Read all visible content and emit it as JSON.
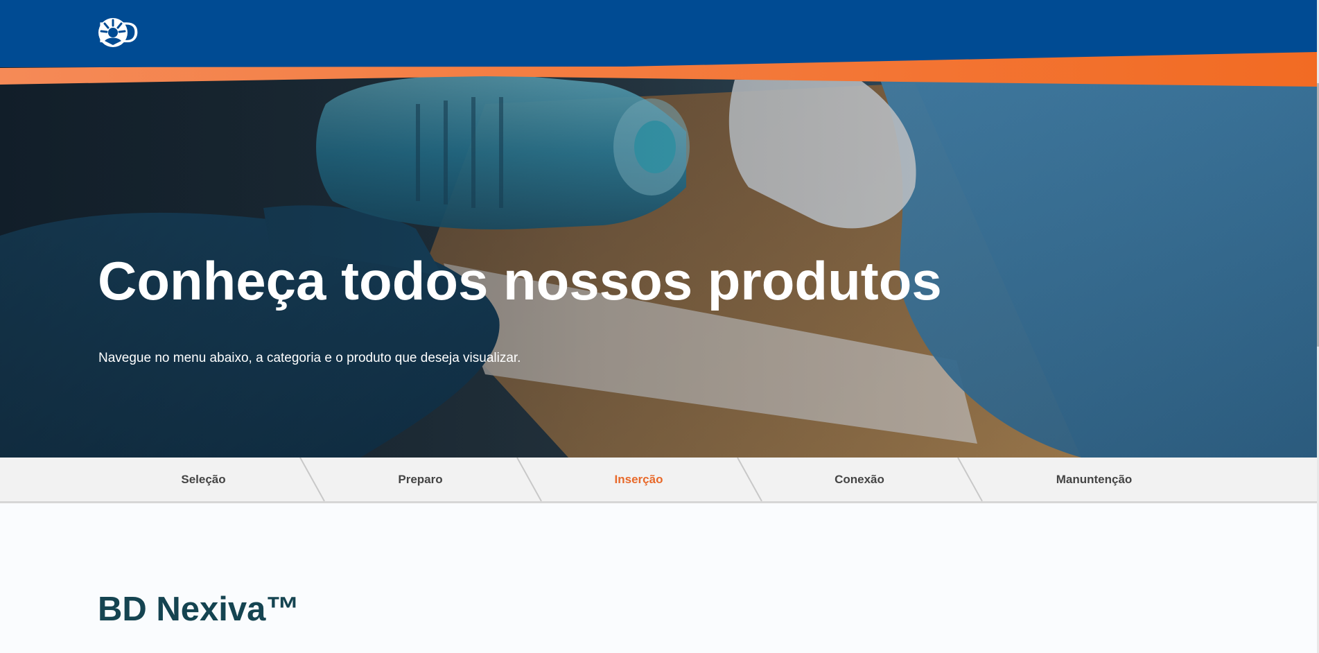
{
  "brand": {
    "logo_text": "BD",
    "colors": {
      "blue": "#004b93",
      "orange": "#f26b23",
      "title": "#154451",
      "active_step": "#e8692a"
    }
  },
  "hero": {
    "title": "Conheça todos nossos produtos",
    "subtitle": "Navegue no menu abaixo, a categoria e o produto que deseja visualizar."
  },
  "steps": {
    "items": [
      {
        "label": "Seleção",
        "active": false
      },
      {
        "label": "Preparo",
        "active": false
      },
      {
        "label": "Inserção",
        "active": true
      },
      {
        "label": "Conexão",
        "active": false
      },
      {
        "label": "Manuntenção",
        "active": false
      }
    ]
  },
  "content": {
    "product_title": "BD Nexiva™"
  }
}
